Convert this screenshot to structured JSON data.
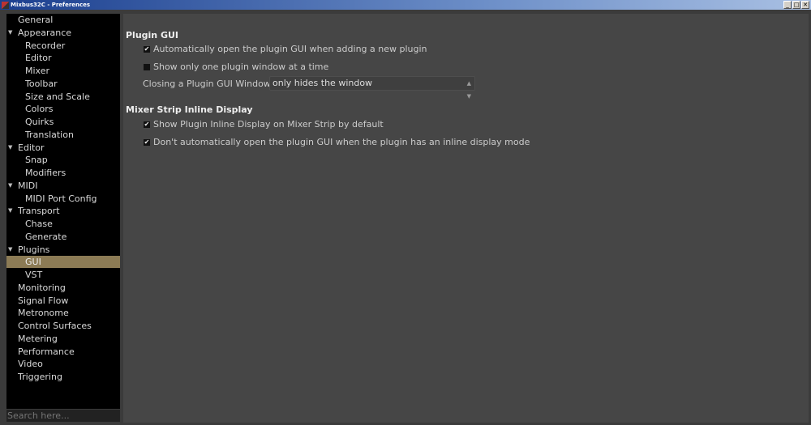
{
  "window": {
    "title": "Mixbus32C - Preferences",
    "minimize": "_",
    "maximize": "□",
    "close": "✕"
  },
  "sidebar": {
    "items": [
      {
        "label": "General",
        "level": 0
      },
      {
        "label": "Appearance",
        "level": 0,
        "expanded": true
      },
      {
        "label": "Recorder",
        "level": 1
      },
      {
        "label": "Editor",
        "level": 1
      },
      {
        "label": "Mixer",
        "level": 1
      },
      {
        "label": "Toolbar",
        "level": 1
      },
      {
        "label": "Size and Scale",
        "level": 1
      },
      {
        "label": "Colors",
        "level": 1
      },
      {
        "label": "Quirks",
        "level": 1
      },
      {
        "label": "Translation",
        "level": 1
      },
      {
        "label": "Editor",
        "level": 0,
        "expanded": true
      },
      {
        "label": "Snap",
        "level": 1
      },
      {
        "label": "Modifiers",
        "level": 1
      },
      {
        "label": "MIDI",
        "level": 0,
        "expanded": true
      },
      {
        "label": "MIDI Port Config",
        "level": 1
      },
      {
        "label": "Transport",
        "level": 0,
        "expanded": true
      },
      {
        "label": "Chase",
        "level": 1
      },
      {
        "label": "Generate",
        "level": 1
      },
      {
        "label": "Plugins",
        "level": 0,
        "expanded": true
      },
      {
        "label": "GUI",
        "level": 1,
        "selected": true
      },
      {
        "label": "VST",
        "level": 1
      },
      {
        "label": "Monitoring",
        "level": 0
      },
      {
        "label": "Signal Flow",
        "level": 0
      },
      {
        "label": "Metronome",
        "level": 0
      },
      {
        "label": "Control Surfaces",
        "level": 0
      },
      {
        "label": "Metering",
        "level": 0
      },
      {
        "label": "Performance",
        "level": 0
      },
      {
        "label": "Video",
        "level": 0
      },
      {
        "label": "Triggering",
        "level": 0
      }
    ],
    "search_placeholder": "Search here..."
  },
  "main": {
    "section1": "Plugin GUI",
    "opt1": {
      "label": "Automatically open the plugin GUI when adding a new plugin",
      "checked": true
    },
    "opt2": {
      "label": "Show only one plugin window at a time",
      "checked": false
    },
    "closing_label": "Closing a Plugin GUI Window:",
    "closing_value": "only hides the window",
    "section2": "Mixer Strip Inline Display",
    "opt3": {
      "label": "Show Plugin Inline Display on Mixer Strip by default",
      "checked": true
    },
    "opt4": {
      "label": "Don't automatically open the plugin GUI when the plugin has an inline display mode",
      "checked": true
    }
  },
  "colors": {
    "selection": "#8c7b55",
    "panel": "#464646",
    "sidebar": "#000000"
  }
}
